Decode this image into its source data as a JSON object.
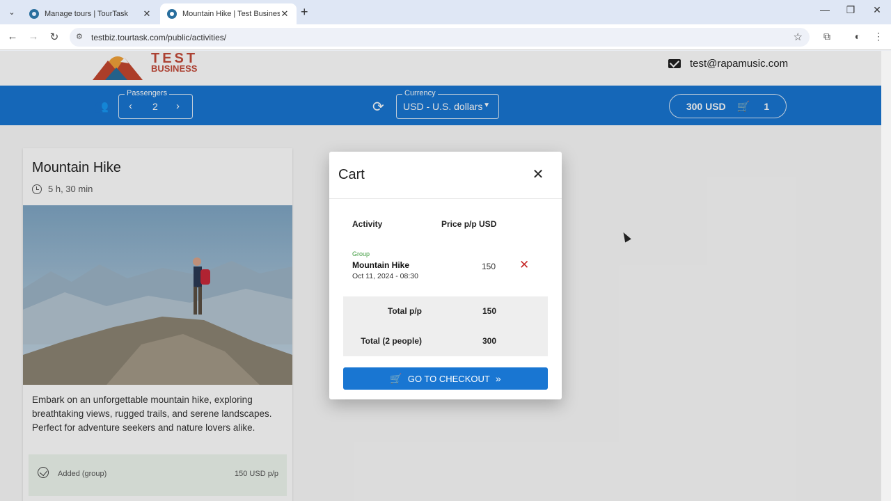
{
  "browser": {
    "tabs": [
      {
        "title": "Manage tours | TourTask"
      },
      {
        "title": "Mountain Hike | Test Business"
      }
    ],
    "url": "testbiz.tourtask.com/public/activities/"
  },
  "header": {
    "brand_line1": "TEST",
    "brand_line2": "BUSINESS",
    "email": "test@rapamusic.com"
  },
  "toolbar": {
    "passengers_label": "Passengers",
    "passengers_count": "2",
    "currency_label": "Currency",
    "currency_value": "USD - U.S. dollars",
    "cart_total": "300 USD",
    "cart_count": "1"
  },
  "card": {
    "title": "Mountain Hike",
    "duration": "5 h, 30 min",
    "description": "Embark on an unforgettable mountain hike, exploring breathtaking views, rugged trails, and serene landscapes. Perfect for adventure seekers and nature lovers alike.",
    "added_label": "Added (group)",
    "added_price": "150 USD p/p"
  },
  "cart": {
    "title": "Cart",
    "col_activity": "Activity",
    "col_price": "Price p/p USD",
    "item": {
      "tag": "Group",
      "name": "Mountain Hike",
      "date": "Oct 11, 2024 - 08:30",
      "price": "150"
    },
    "total_pp_label": "Total p/p",
    "total_pp_value": "150",
    "total_people_label": "Total (2 people)",
    "total_people_value": "300",
    "checkout_label": "GO TO CHECKOUT"
  },
  "colors": {
    "primary": "#1976d2",
    "remove": "#c62828",
    "tag": "#3c9a3c"
  }
}
